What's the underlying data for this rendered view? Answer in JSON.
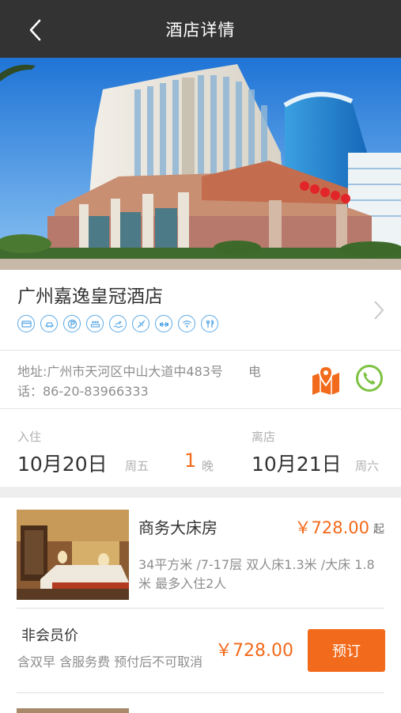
{
  "navbar": {
    "title": "酒店详情",
    "back_icon": "back-chevron-icon"
  },
  "hotel": {
    "name": "广州嘉逸皇冠酒店",
    "amenity_icons": [
      "credit-card-icon",
      "parking-icon",
      "parking-p-icon",
      "meeting-icon",
      "swimming-icon",
      "airport-shuttle-icon",
      "gym-icon",
      "wifi-icon",
      "restaurant-icon"
    ],
    "address_line1": "地址:广州市天河区中山大道中483号",
    "address_tel_prefix": "电",
    "address_line2": "话：86-20-83966333"
  },
  "stay": {
    "checkin_label": "入住",
    "checkin_date": "10月20日",
    "checkin_weekday": "周五",
    "nights_count": "1",
    "nights_unit": "晚",
    "checkout_label": "离店",
    "checkout_date": "10月21日",
    "checkout_weekday": "周六"
  },
  "room": {
    "name": "商务大床房",
    "price": "￥728.00",
    "price_suffix": "起",
    "description": "34平方米 /7-17层   双人床1.3米 /大床 1.8米 最多入住2人"
  },
  "rate": {
    "name": "非会员价",
    "description": "含双早 含服务费 预付后不可取消",
    "price": "￥728.00",
    "book_label": "预订"
  },
  "colors": {
    "accent": "#f26a1b",
    "navbar": "#333333",
    "amenity": "#5aa9e6",
    "phone": "#7dc242"
  }
}
